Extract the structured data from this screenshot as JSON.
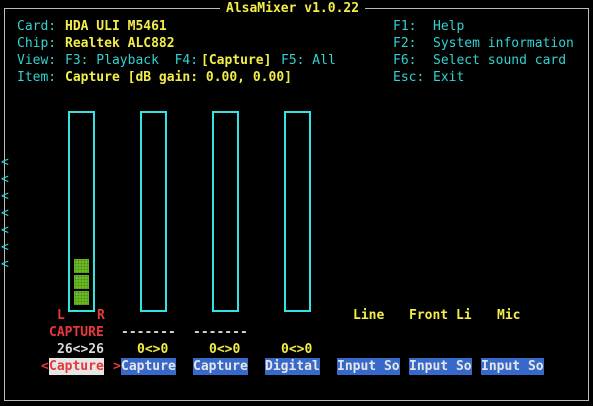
{
  "title": "AlsaMixer v1.0.22",
  "info": {
    "card_label": "Card:",
    "card_value": "HDA ULI M5461",
    "chip_label": "Chip:",
    "chip_value": "Realtek ALC882",
    "view_label": "View:",
    "view_f3": "F3: Playback  F4:",
    "view_current": "[Capture]",
    "view_f5": "F5: All",
    "item_label": "Item:",
    "item_value": "Capture [dB gain: 0.00, 0.00]"
  },
  "shortcuts": [
    {
      "key": "F1:",
      "label": "Help"
    },
    {
      "key": "F2:",
      "label": "System information"
    },
    {
      "key": "F6:",
      "label": "Select sound card"
    },
    {
      "key": "Esc:",
      "label": "Exit"
    }
  ],
  "channels": [
    {
      "name": "Capture",
      "value": "26<>26",
      "left": "L",
      "right": "R",
      "capture_state": "CAPTURE",
      "level": 0.2,
      "selected": true
    },
    {
      "name": "Capture",
      "value": "0<>0",
      "capture_state": "-------",
      "level": 0
    },
    {
      "name": "Capture",
      "value": "0<>0",
      "capture_state": "-------",
      "level": 0
    },
    {
      "name": "Digital",
      "value": "0<>0",
      "level": 0
    },
    {
      "name": "Input So",
      "enum_label": "Line"
    },
    {
      "name": "Input So",
      "enum_label": "Front Li"
    },
    {
      "name": "Input So",
      "enum_label": "Mic"
    }
  ],
  "selection_markers": {
    "left": "<",
    "right": ">"
  },
  "scroll_arrow": "<"
}
